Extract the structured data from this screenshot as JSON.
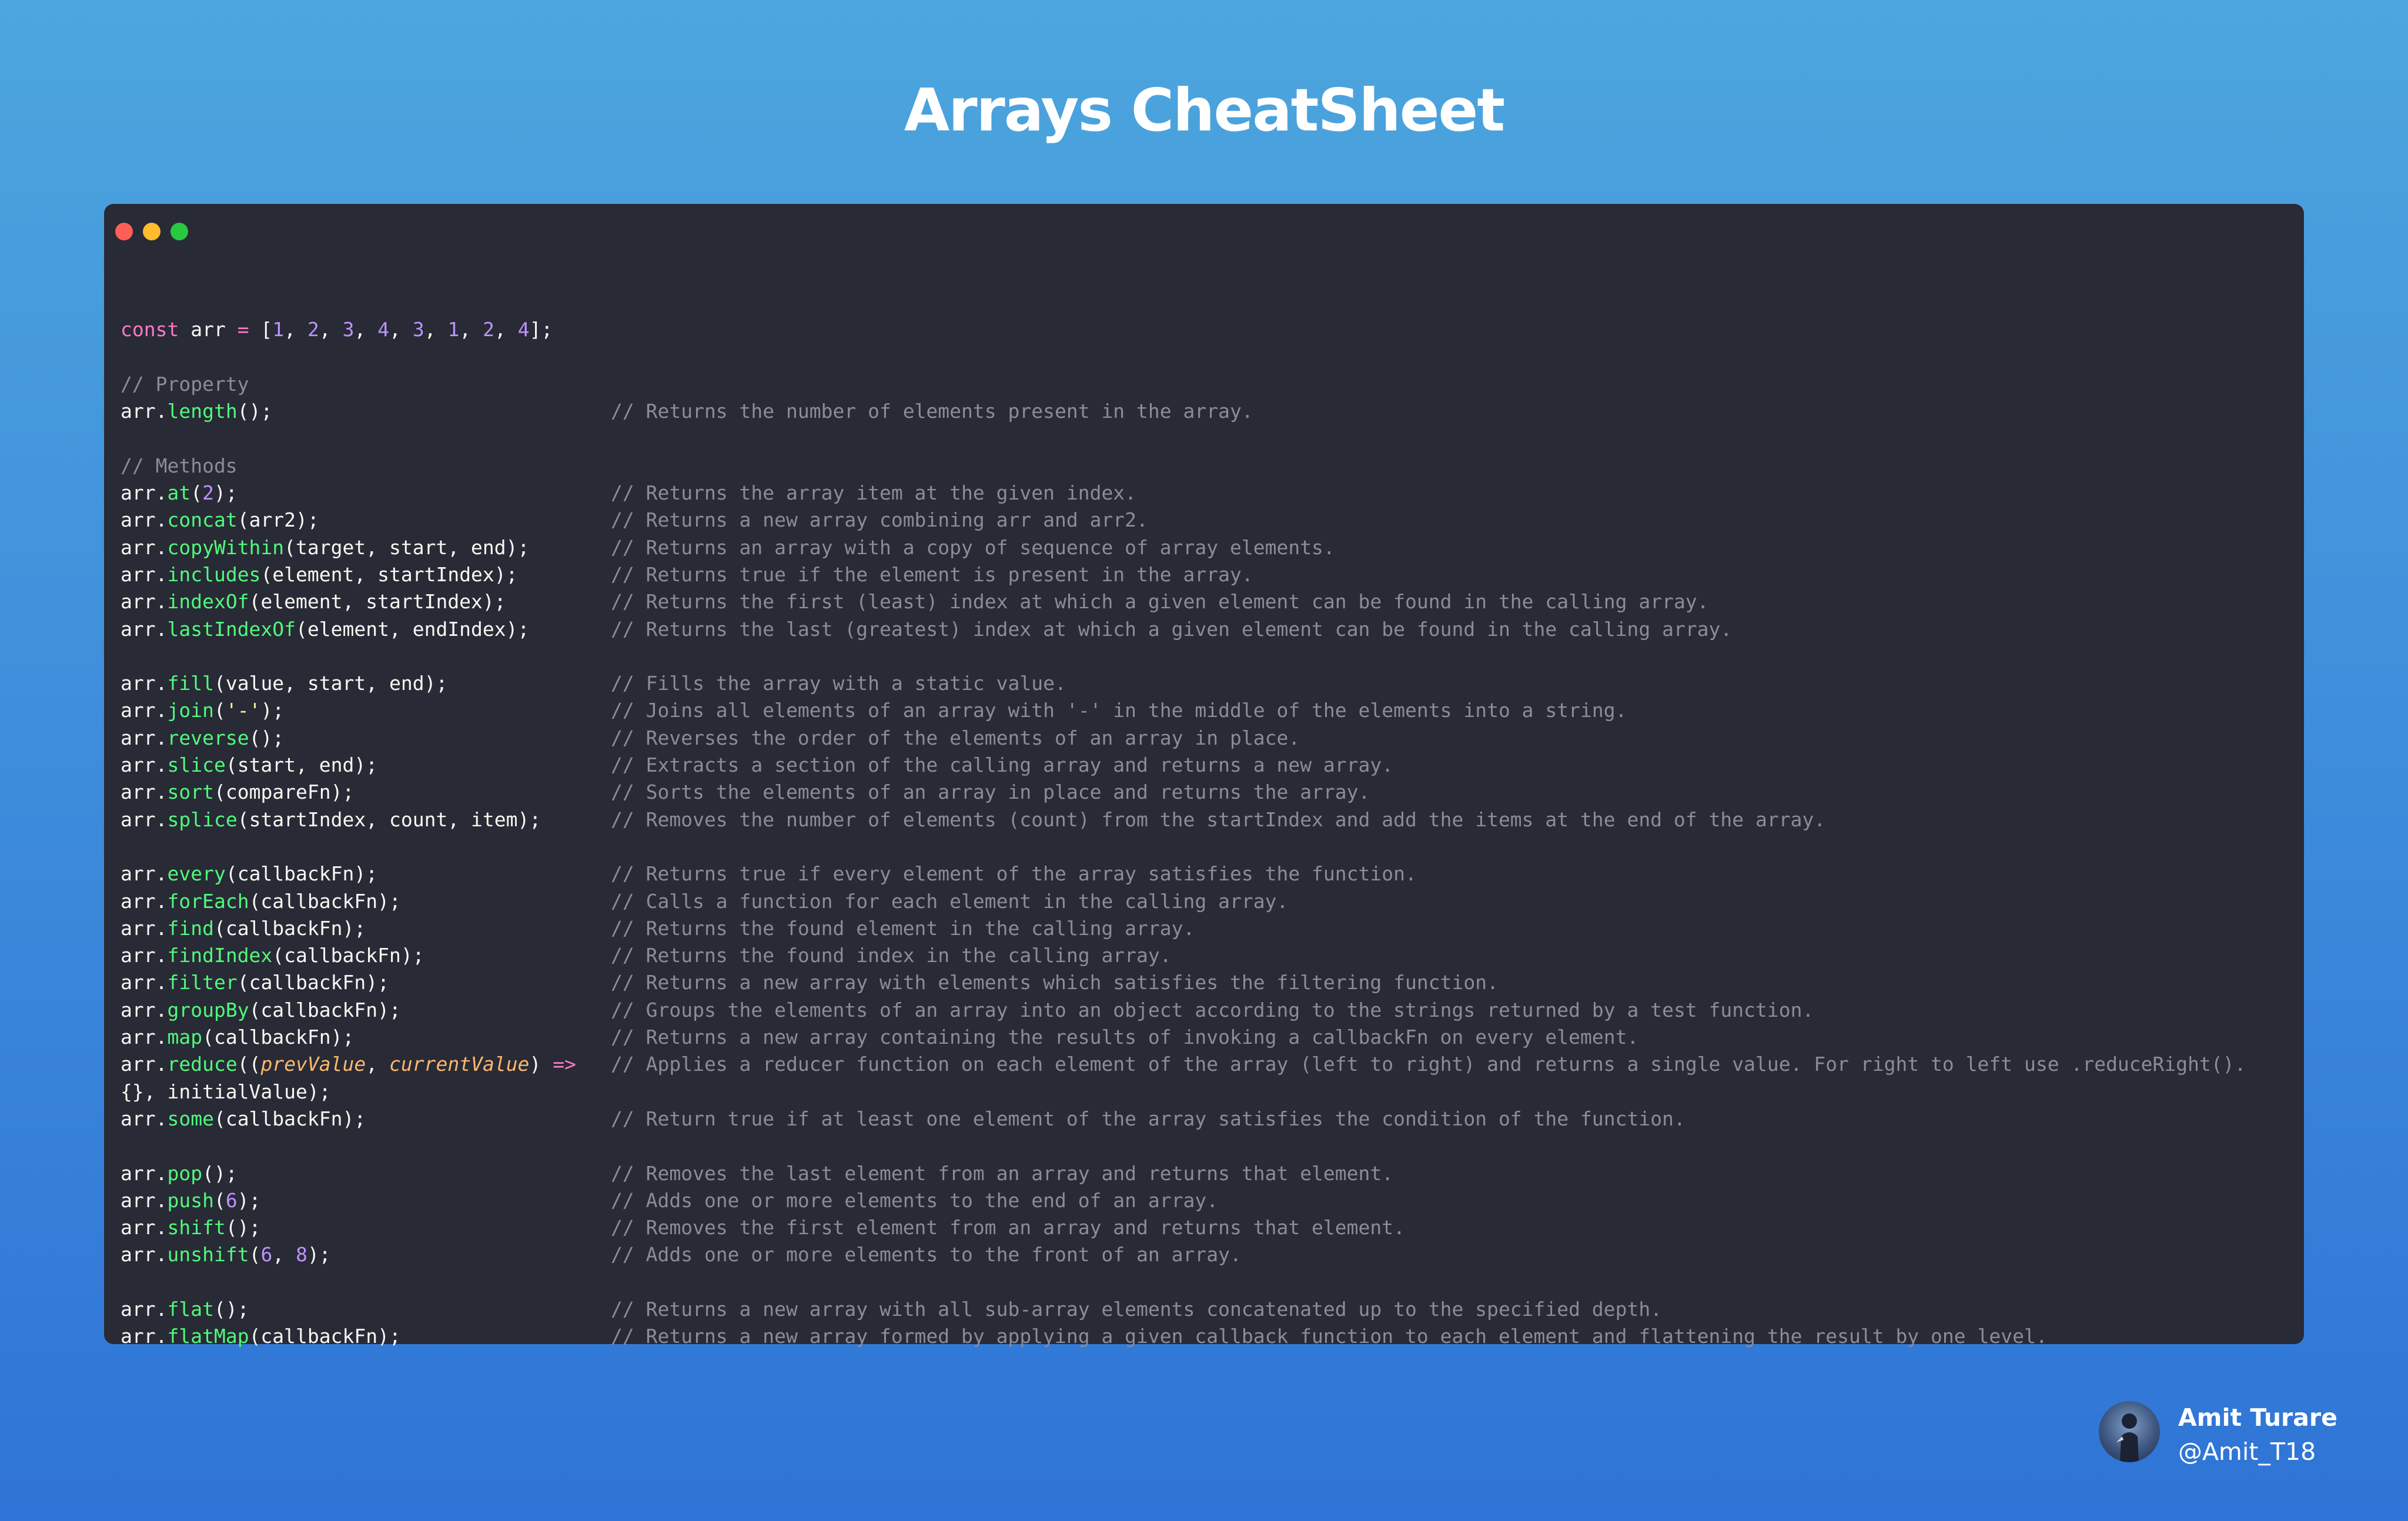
{
  "title": "Arrays CheatSheet",
  "window": {
    "dots": [
      {
        "name": "close",
        "color": "#ff5f57"
      },
      {
        "name": "minimize",
        "color": "#febc2e"
      },
      {
        "name": "maximize",
        "color": "#28c840"
      }
    ]
  },
  "code": {
    "decl": {
      "kw": "const",
      "name": " arr ",
      "op": "=",
      "open": " [",
      "nums": [
        "1",
        "2",
        "3",
        "4",
        "3",
        "1",
        "2",
        "4"
      ],
      "close": "];"
    },
    "property_header": "// Property",
    "property": {
      "obj": "arr.",
      "fn": "length",
      "args": "();",
      "comment": "// Returns the number of elements present in the array."
    },
    "methods_header": "// Methods",
    "groups": [
      [
        {
          "fn": "at",
          "pre": "(",
          "num": "2",
          "post": ");",
          "comment": "// Returns the array item at the given index."
        },
        {
          "fn": "concat",
          "args": "(arr2);",
          "comment": "// Returns a new array combining arr and arr2."
        },
        {
          "fn": "copyWithin",
          "args": "(target, start, end);",
          "comment": "// Returns an array with a copy of sequence of array elements."
        },
        {
          "fn": "includes",
          "args": "(element, startIndex);",
          "comment": "// Returns true if the element is present in the array."
        },
        {
          "fn": "indexOf",
          "args": "(element, startIndex);",
          "comment": "// Returns the first (least) index at which a given element can be found in the calling array."
        },
        {
          "fn": "lastIndexOf",
          "args": "(element, endIndex);",
          "comment": "// Returns the last (greatest) index at which a given element can be found in the calling array."
        }
      ],
      [
        {
          "fn": "fill",
          "args": "(value, start, end);",
          "comment": "// Fills the array with a static value."
        },
        {
          "fn": "join",
          "pre": "(",
          "str": "'-'",
          "post": ");",
          "comment": "// Joins all elements of an array with '-' in the middle of the elements into a string."
        },
        {
          "fn": "reverse",
          "args": "();",
          "comment": "// Reverses the order of the elements of an array in place."
        },
        {
          "fn": "slice",
          "args": "(start, end);",
          "comment": "// Extracts a section of the calling array and returns a new array."
        },
        {
          "fn": "sort",
          "args": "(compareFn);",
          "comment": "// Sorts the elements of an array in place and returns the array."
        },
        {
          "fn": "splice",
          "args": "(startIndex, count, item);",
          "comment": "// Removes the number of elements (count) from the startIndex and add the items at the end of the array."
        }
      ],
      [
        {
          "fn": "every",
          "args": "(callbackFn);",
          "comment": "// Returns true if every element of the array satisfies the function."
        },
        {
          "fn": "forEach",
          "args": "(callbackFn);",
          "comment": "// Calls a function for each element in the calling array."
        },
        {
          "fn": "find",
          "args": "(callbackFn);",
          "comment": "// Returns the found element in the calling array."
        },
        {
          "fn": "findIndex",
          "args": "(callbackFn);",
          "comment": "// Returns the found index in the calling array."
        },
        {
          "fn": "filter",
          "args": "(callbackFn);",
          "comment": "// Returns a new array with elements which satisfies the filtering function."
        },
        {
          "fn": "groupBy",
          "args": "(callbackFn);",
          "comment": "// Groups the elements of an array into an object according to the strings returned by a test function."
        },
        {
          "fn": "map",
          "args": "(callbackFn);",
          "comment": "// Returns a new array containing the results of invoking a callbackFn on every element."
        }
      ],
      [
        {
          "fn": "some",
          "args": "(callbackFn);",
          "comment": "// Return true if at least one element of the array satisfies the condition of the function."
        }
      ],
      [
        {
          "fn": "pop",
          "args": "();",
          "comment": "// Removes the last element from an array and returns that element."
        },
        {
          "fn": "push",
          "pre": "(",
          "num": "6",
          "post": ");",
          "comment": "// Adds one or more elements to the end of an array."
        },
        {
          "fn": "shift",
          "args": "();",
          "comment": "// Removes the first element from an array and returns that element."
        },
        {
          "fn": "unshift",
          "pre": "(",
          "num": "6",
          "mid": ", ",
          "num2": "8",
          "post": ");",
          "comment": "// Adds one or more elements to the front of an array."
        }
      ],
      [
        {
          "fn": "flat",
          "args": "();",
          "comment": "// Returns a new array with all sub-array elements concatenated up to the specified depth."
        },
        {
          "fn": "flatMap",
          "args": "(callbackFn);",
          "comment": "// Returns a new array formed by applying a given callback function to each element and flattening the result by one level."
        }
      ]
    ],
    "reduce": {
      "fn": "reduce",
      "open": "((",
      "p1": "prevValue",
      "sep": ", ",
      "p2": "currentValue",
      "close": ") ",
      "arrow": "=>",
      "cont": "{}, initialValue);",
      "comment": "// Applies a reducer function on each element of the array (left to right) and returns a single value. For right to left use .reduceRight()."
    }
  },
  "author": {
    "name": "Amit Turare",
    "handle": "@Amit_T18",
    "avatar_icon": "profile-photo"
  }
}
